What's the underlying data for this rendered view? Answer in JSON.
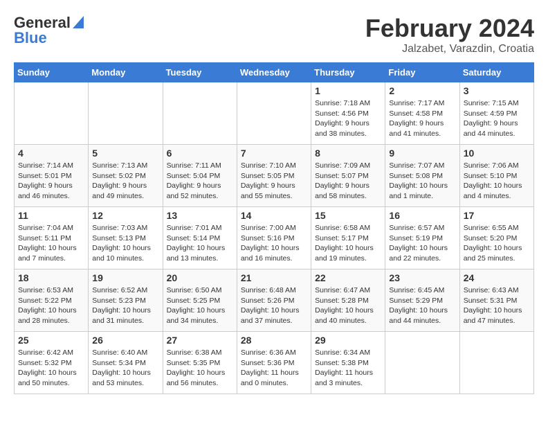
{
  "header": {
    "logo_general": "General",
    "logo_blue": "Blue",
    "month_title": "February 2024",
    "location": "Jalzabet, Varazdin, Croatia"
  },
  "weekdays": [
    "Sunday",
    "Monday",
    "Tuesday",
    "Wednesday",
    "Thursday",
    "Friday",
    "Saturday"
  ],
  "weeks": [
    [
      {
        "day": "",
        "info": ""
      },
      {
        "day": "",
        "info": ""
      },
      {
        "day": "",
        "info": ""
      },
      {
        "day": "",
        "info": ""
      },
      {
        "day": "1",
        "info": "Sunrise: 7:18 AM\nSunset: 4:56 PM\nDaylight: 9 hours\nand 38 minutes."
      },
      {
        "day": "2",
        "info": "Sunrise: 7:17 AM\nSunset: 4:58 PM\nDaylight: 9 hours\nand 41 minutes."
      },
      {
        "day": "3",
        "info": "Sunrise: 7:15 AM\nSunset: 4:59 PM\nDaylight: 9 hours\nand 44 minutes."
      }
    ],
    [
      {
        "day": "4",
        "info": "Sunrise: 7:14 AM\nSunset: 5:01 PM\nDaylight: 9 hours\nand 46 minutes."
      },
      {
        "day": "5",
        "info": "Sunrise: 7:13 AM\nSunset: 5:02 PM\nDaylight: 9 hours\nand 49 minutes."
      },
      {
        "day": "6",
        "info": "Sunrise: 7:11 AM\nSunset: 5:04 PM\nDaylight: 9 hours\nand 52 minutes."
      },
      {
        "day": "7",
        "info": "Sunrise: 7:10 AM\nSunset: 5:05 PM\nDaylight: 9 hours\nand 55 minutes."
      },
      {
        "day": "8",
        "info": "Sunrise: 7:09 AM\nSunset: 5:07 PM\nDaylight: 9 hours\nand 58 minutes."
      },
      {
        "day": "9",
        "info": "Sunrise: 7:07 AM\nSunset: 5:08 PM\nDaylight: 10 hours\nand 1 minute."
      },
      {
        "day": "10",
        "info": "Sunrise: 7:06 AM\nSunset: 5:10 PM\nDaylight: 10 hours\nand 4 minutes."
      }
    ],
    [
      {
        "day": "11",
        "info": "Sunrise: 7:04 AM\nSunset: 5:11 PM\nDaylight: 10 hours\nand 7 minutes."
      },
      {
        "day": "12",
        "info": "Sunrise: 7:03 AM\nSunset: 5:13 PM\nDaylight: 10 hours\nand 10 minutes."
      },
      {
        "day": "13",
        "info": "Sunrise: 7:01 AM\nSunset: 5:14 PM\nDaylight: 10 hours\nand 13 minutes."
      },
      {
        "day": "14",
        "info": "Sunrise: 7:00 AM\nSunset: 5:16 PM\nDaylight: 10 hours\nand 16 minutes."
      },
      {
        "day": "15",
        "info": "Sunrise: 6:58 AM\nSunset: 5:17 PM\nDaylight: 10 hours\nand 19 minutes."
      },
      {
        "day": "16",
        "info": "Sunrise: 6:57 AM\nSunset: 5:19 PM\nDaylight: 10 hours\nand 22 minutes."
      },
      {
        "day": "17",
        "info": "Sunrise: 6:55 AM\nSunset: 5:20 PM\nDaylight: 10 hours\nand 25 minutes."
      }
    ],
    [
      {
        "day": "18",
        "info": "Sunrise: 6:53 AM\nSunset: 5:22 PM\nDaylight: 10 hours\nand 28 minutes."
      },
      {
        "day": "19",
        "info": "Sunrise: 6:52 AM\nSunset: 5:23 PM\nDaylight: 10 hours\nand 31 minutes."
      },
      {
        "day": "20",
        "info": "Sunrise: 6:50 AM\nSunset: 5:25 PM\nDaylight: 10 hours\nand 34 minutes."
      },
      {
        "day": "21",
        "info": "Sunrise: 6:48 AM\nSunset: 5:26 PM\nDaylight: 10 hours\nand 37 minutes."
      },
      {
        "day": "22",
        "info": "Sunrise: 6:47 AM\nSunset: 5:28 PM\nDaylight: 10 hours\nand 40 minutes."
      },
      {
        "day": "23",
        "info": "Sunrise: 6:45 AM\nSunset: 5:29 PM\nDaylight: 10 hours\nand 44 minutes."
      },
      {
        "day": "24",
        "info": "Sunrise: 6:43 AM\nSunset: 5:31 PM\nDaylight: 10 hours\nand 47 minutes."
      }
    ],
    [
      {
        "day": "25",
        "info": "Sunrise: 6:42 AM\nSunset: 5:32 PM\nDaylight: 10 hours\nand 50 minutes."
      },
      {
        "day": "26",
        "info": "Sunrise: 6:40 AM\nSunset: 5:34 PM\nDaylight: 10 hours\nand 53 minutes."
      },
      {
        "day": "27",
        "info": "Sunrise: 6:38 AM\nSunset: 5:35 PM\nDaylight: 10 hours\nand 56 minutes."
      },
      {
        "day": "28",
        "info": "Sunrise: 6:36 AM\nSunset: 5:36 PM\nDaylight: 11 hours\nand 0 minutes."
      },
      {
        "day": "29",
        "info": "Sunrise: 6:34 AM\nSunset: 5:38 PM\nDaylight: 11 hours\nand 3 minutes."
      },
      {
        "day": "",
        "info": ""
      },
      {
        "day": "",
        "info": ""
      }
    ]
  ]
}
